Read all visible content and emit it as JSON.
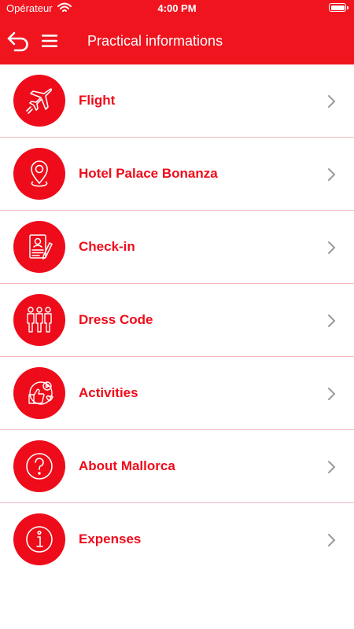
{
  "status_bar": {
    "carrier": "Opérateur",
    "time": "4:00 PM"
  },
  "header": {
    "title": "Practical informations"
  },
  "items": [
    {
      "label": "Flight",
      "icon": "airplane-icon"
    },
    {
      "label": "Hotel Palace Bonanza",
      "icon": "location-pin-icon"
    },
    {
      "label": "Check-in",
      "icon": "checkin-form-icon"
    },
    {
      "label": "Dress Code",
      "icon": "dress-code-icon"
    },
    {
      "label": "Activities",
      "icon": "activities-icon"
    },
    {
      "label": "About Mallorca",
      "icon": "question-icon"
    },
    {
      "label": "Expenses",
      "icon": "info-icon"
    }
  ],
  "colors": {
    "brand": "#f0141f",
    "divider": "#f2b9bf",
    "chevron": "#9a9a9a"
  }
}
